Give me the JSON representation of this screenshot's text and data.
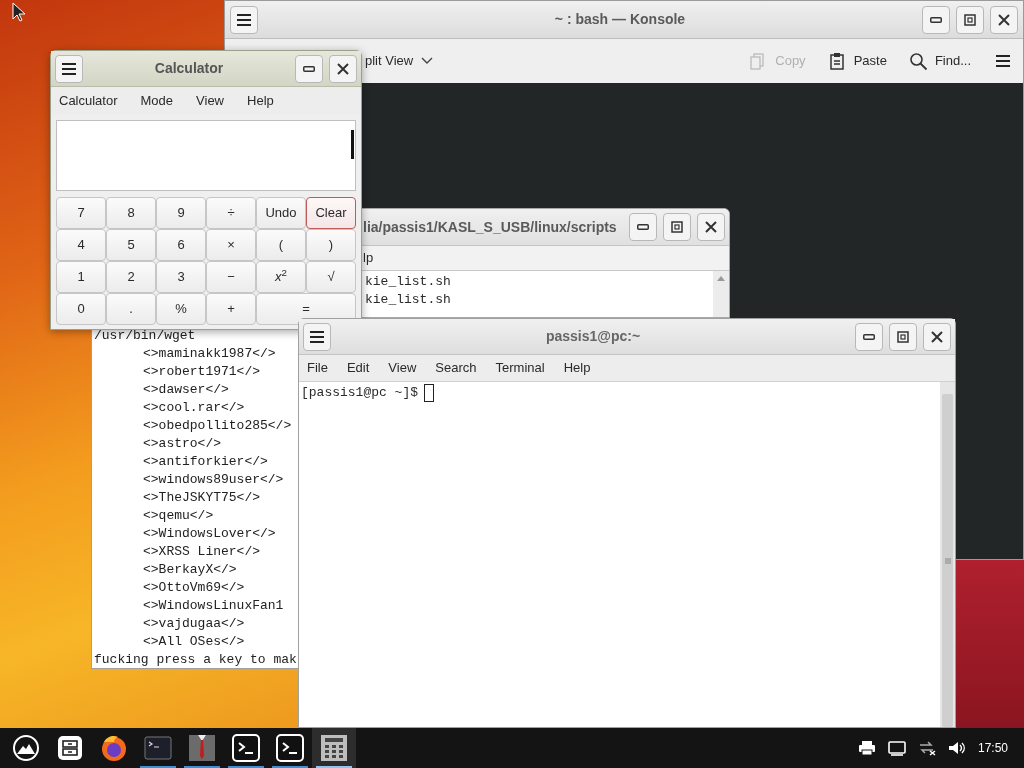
{
  "konsole": {
    "title": "~ : bash — Konsole",
    "toolbar": {
      "split_view": "plit View",
      "actions": [
        {
          "kind": "copy",
          "label": "Copy",
          "disabled": true
        },
        {
          "kind": "paste",
          "label": "Paste",
          "disabled": false
        },
        {
          "kind": "find",
          "label": "Find...",
          "disabled": false
        }
      ]
    }
  },
  "scripts_window": {
    "title": "lia/passis1/KASL_S_USB/linux/scripts",
    "menu": [
      "lp"
    ],
    "lines": [
      "kie_list.sh",
      "kie_list.sh"
    ]
  },
  "log_window": {
    "lines": [
      {
        "text": "/usr/bin/wget",
        "indented": false
      },
      {
        "text": "<>maminakk1987</>",
        "indented": true
      },
      {
        "text": "<>robert1971</>",
        "indented": true
      },
      {
        "text": "<>dawser</>",
        "indented": true
      },
      {
        "text": "<>cool.rar</>",
        "indented": true
      },
      {
        "text": "<>obedpollito285</>",
        "indented": true
      },
      {
        "text": "<>astro</>",
        "indented": true
      },
      {
        "text": "<>antiforkier</>",
        "indented": true
      },
      {
        "text": "<>windows89user</>",
        "indented": true
      },
      {
        "text": "<>TheJSKYT75</>",
        "indented": true
      },
      {
        "text": "<>qemu</>",
        "indented": true
      },
      {
        "text": "<>WindowsLover</>",
        "indented": true
      },
      {
        "text": "<>XRSS Liner</>",
        "indented": true
      },
      {
        "text": "<>BerkayX</>",
        "indented": true
      },
      {
        "text": "<>OttoVm69</>",
        "indented": true
      },
      {
        "text": "<>WindowsLinuxFan1",
        "indented": true
      },
      {
        "text": "<>vajdugaa</>",
        "indented": true
      },
      {
        "text": "<>All OSes</>",
        "indented": true
      },
      {
        "text": "fucking press a key to mak",
        "indented": false
      }
    ]
  },
  "calculator": {
    "title": "Calculator",
    "menu": [
      "Calculator",
      "Mode",
      "View",
      "Help"
    ],
    "keys": [
      {
        "label": "7",
        "wide": false,
        "highlighted": false
      },
      {
        "label": "8",
        "wide": false,
        "highlighted": false
      },
      {
        "label": "9",
        "wide": false,
        "highlighted": false
      },
      {
        "label": "÷",
        "wide": false,
        "highlighted": false
      },
      {
        "label": "Undo",
        "wide": false,
        "highlighted": false
      },
      {
        "label": "Clear",
        "wide": false,
        "highlighted": true
      },
      {
        "label": "4",
        "wide": false,
        "highlighted": false
      },
      {
        "label": "5",
        "wide": false,
        "highlighted": false
      },
      {
        "label": "6",
        "wide": false,
        "highlighted": false
      },
      {
        "label": "×",
        "wide": false,
        "highlighted": false
      },
      {
        "label": "(",
        "wide": false,
        "highlighted": false
      },
      {
        "label": ")",
        "wide": false,
        "highlighted": false
      },
      {
        "label": "1",
        "wide": false,
        "highlighted": false
      },
      {
        "label": "2",
        "wide": false,
        "highlighted": false
      },
      {
        "label": "3",
        "wide": false,
        "highlighted": false
      },
      {
        "label": "−",
        "wide": false,
        "highlighted": false
      },
      {
        "label": "*x*$^{2}$",
        "wide": false,
        "highlighted": false
      },
      {
        "label": "√",
        "wide": false,
        "highlighted": false
      },
      {
        "label": "0",
        "wide": false,
        "highlighted": false
      },
      {
        "label": ".",
        "wide": false,
        "highlighted": false
      },
      {
        "label": "%",
        "wide": false,
        "highlighted": false
      },
      {
        "label": "+",
        "wide": false,
        "highlighted": false
      },
      {
        "label": "=",
        "wide": true,
        "highlighted": false
      }
    ]
  },
  "terminal": {
    "title": "passis1@pc:~",
    "menu": [
      "File",
      "Edit",
      "View",
      "Search",
      "Terminal",
      "Help"
    ],
    "prompt": "[passis1@pc ~]$"
  },
  "taskbar": {
    "apps": [
      {
        "kind": "launcher",
        "running": false,
        "active": false
      },
      {
        "kind": "files",
        "running": false,
        "active": false
      },
      {
        "kind": "browser",
        "running": false,
        "active": false
      },
      {
        "kind": "terminal",
        "running": true,
        "active": false
      },
      {
        "kind": "suit",
        "running": true,
        "active": false
      },
      {
        "kind": "console",
        "running": true,
        "active": false
      },
      {
        "kind": "console",
        "running": true,
        "active": false
      },
      {
        "kind": "calculator",
        "running": true,
        "active": true
      }
    ],
    "clock": "17:50"
  }
}
